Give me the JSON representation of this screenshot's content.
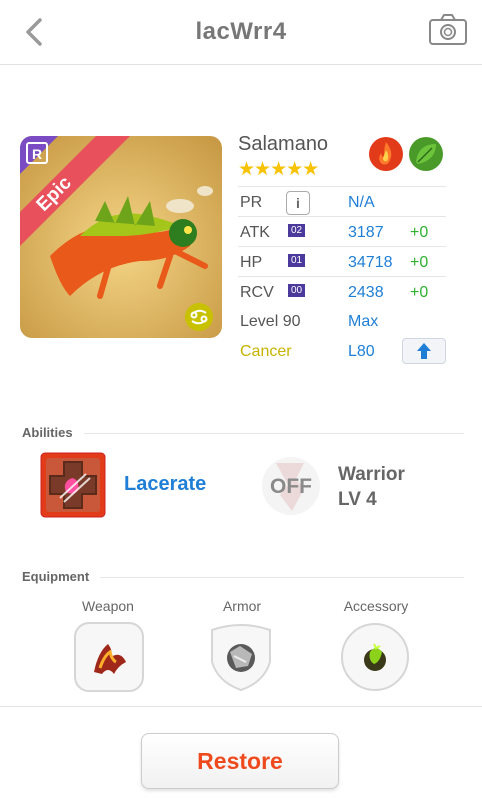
{
  "header": {
    "title": "lacWrr4"
  },
  "monster": {
    "rarity": "Epic",
    "rank_badge": "R",
    "name": "Salamano",
    "stars": "★★★★★",
    "star_count": 5,
    "elements": [
      "fire-icon",
      "leaf-icon"
    ],
    "zodiac_icon": "cancer-zodiac-icon"
  },
  "stats": {
    "pr": {
      "label": "PR",
      "value": "N/A"
    },
    "atk": {
      "label": "ATK",
      "badge": "02",
      "value": "3187",
      "bonus": "+0"
    },
    "hp": {
      "label": "HP",
      "badge": "01",
      "value": "34718",
      "bonus": "+0"
    },
    "rcv": {
      "label": "RCV",
      "badge": "00",
      "value": "2438",
      "bonus": "+0"
    },
    "level": {
      "label": "Level 90",
      "value": "Max"
    },
    "sign": {
      "label": "Cancer",
      "value": "L80"
    }
  },
  "abilities": {
    "title": "Abilities",
    "primary": {
      "name": "Lacerate"
    },
    "secondary": {
      "status": "OFF",
      "name_line1": "Warrior",
      "name_line2": "LV 4"
    }
  },
  "equipment": {
    "title": "Equipment",
    "slots": [
      {
        "label": "Weapon",
        "icon": "weapon-icon"
      },
      {
        "label": "Armor",
        "icon": "armor-icon"
      },
      {
        "label": "Accessory",
        "icon": "accessory-icon"
      }
    ]
  },
  "footer": {
    "restore_label": "Restore"
  },
  "colors": {
    "accent_blue": "#1f7fd6",
    "bonus_green": "#2fb02f",
    "restore_orange": "#ef4a1e",
    "cancer_yellow": "#c8b300",
    "epic_ribbon": "#e8505b",
    "badge_purple": "#4b3a9c"
  }
}
